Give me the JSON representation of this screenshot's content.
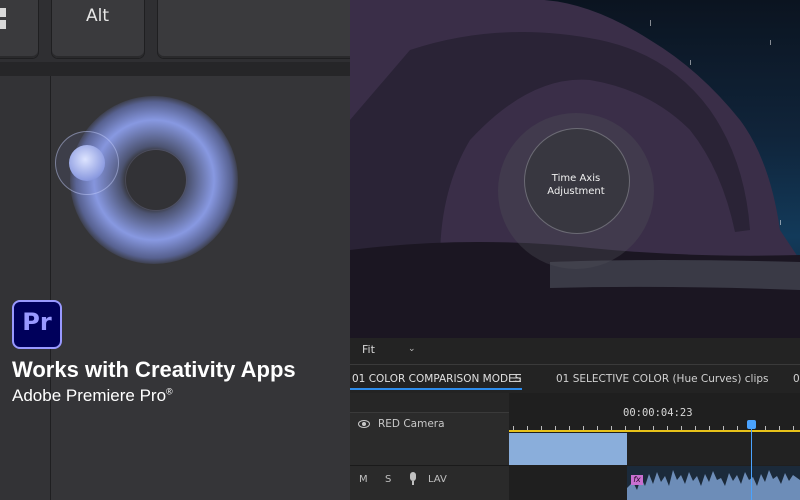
{
  "keyboard": {
    "alt_key_label": "Alt",
    "windows_key_icon": "windows-icon"
  },
  "touchpad": {
    "gesture_ring_icon": "rotation-dial-ring",
    "touch_point_icon": "finger-touch-point"
  },
  "branding": {
    "app_logo_text": "Pr",
    "app_logo_colors": {
      "background": "#00005b",
      "text": "#9999ff"
    },
    "headline": "Works with Creativity Apps",
    "subheadline": "Adobe Premiere Pro",
    "trademark": "®"
  },
  "viewer": {
    "dial_label_line1": "Time Axis",
    "dial_label_line2": "Adjustment",
    "zoom_select": "Fit"
  },
  "tabs": [
    {
      "label": "01 COLOR COMPARISON MODES",
      "active": true
    },
    {
      "label": "01 SELECTIVE COLOR (Hue Curves) clips",
      "active": false
    },
    {
      "label": "0",
      "active": false
    }
  ],
  "timeline": {
    "timecode": "00:00:04:23",
    "video_track_name": "RED Camera",
    "audio_buttons": {
      "mute": "M",
      "solo": "S"
    },
    "audio_track_name": "LAV",
    "fx_badge": "fx",
    "colors": {
      "ruler": "#e8c21a",
      "playhead": "#4aa3ff",
      "video_clip": "#8aaedb"
    }
  }
}
